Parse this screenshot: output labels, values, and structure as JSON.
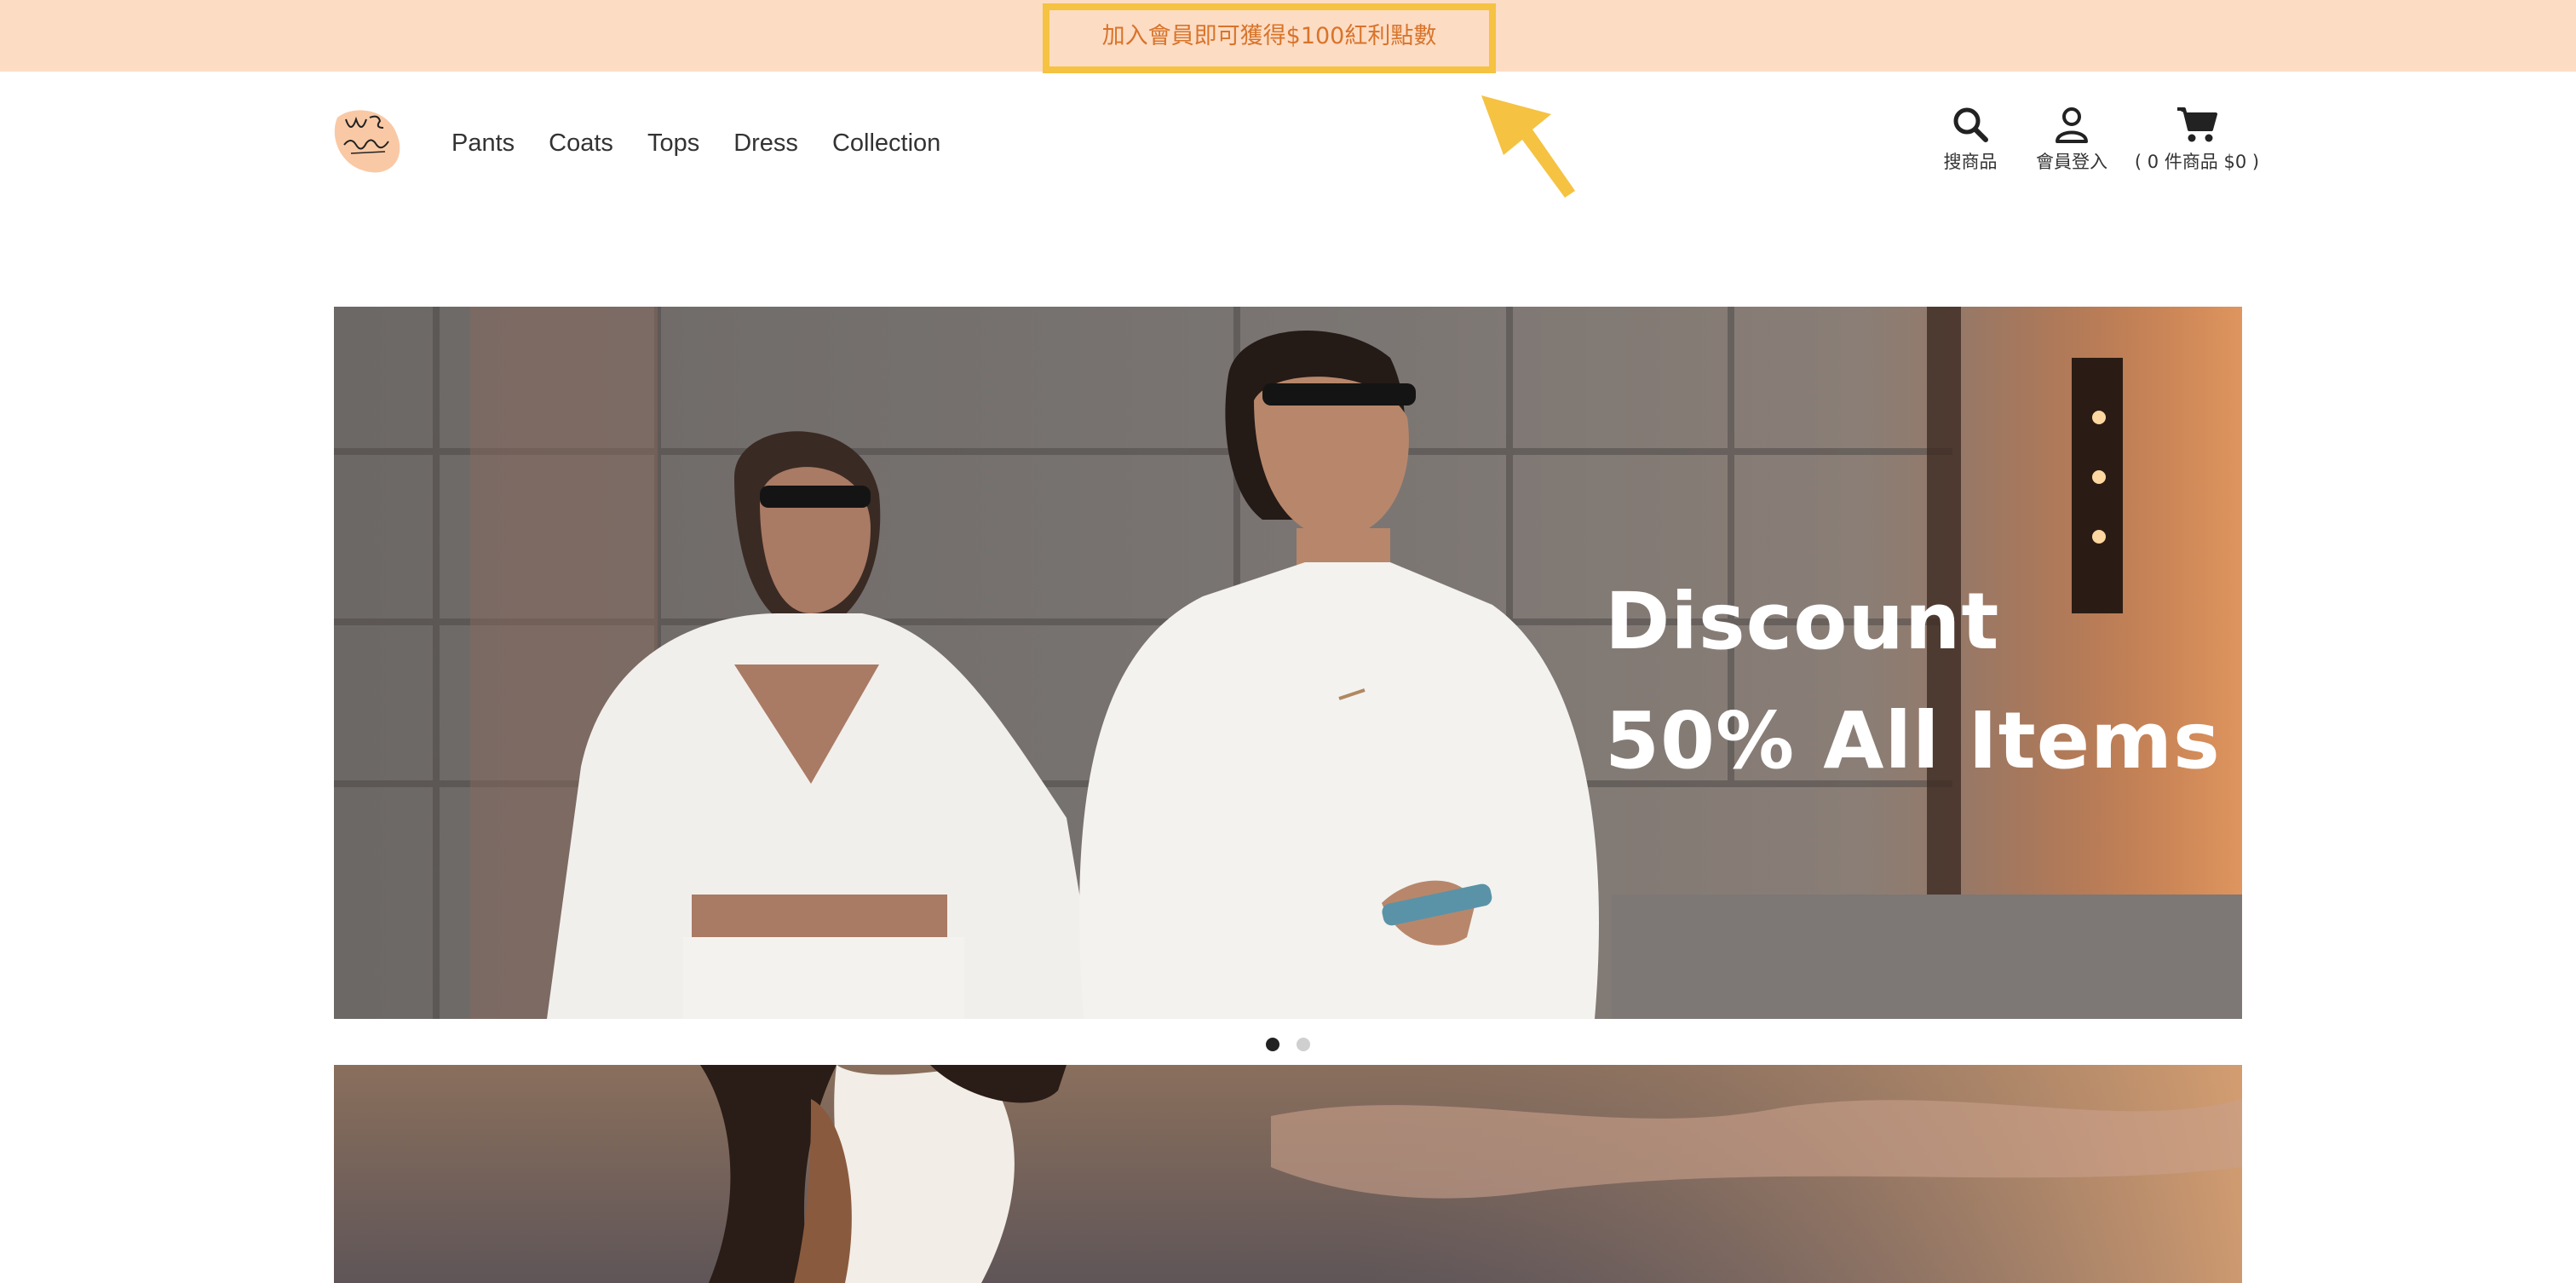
{
  "announcement": {
    "text": "加入會員即可獲得$100紅利點數"
  },
  "logo": {
    "alt": "Warm Embrace"
  },
  "nav": {
    "items": [
      {
        "label": "Pants"
      },
      {
        "label": "Coats"
      },
      {
        "label": "Tops"
      },
      {
        "label": "Dress"
      },
      {
        "label": "Collection"
      }
    ]
  },
  "header_tools": {
    "search_label": "搜商品",
    "member_label": "會員登入",
    "cart_label": "( 0 件商品 $0 )",
    "icons": {
      "search": "search-icon",
      "member": "user-icon",
      "cart": "cart-icon"
    }
  },
  "carousel": {
    "slide_line1": "Discount",
    "slide_line2": "50% All Items",
    "slides_count": 2,
    "active_index": 0
  },
  "colors": {
    "announce_bg": "#fddcc4",
    "announce_text": "#d8742a",
    "highlight": "#f5c242",
    "text": "#333333"
  }
}
